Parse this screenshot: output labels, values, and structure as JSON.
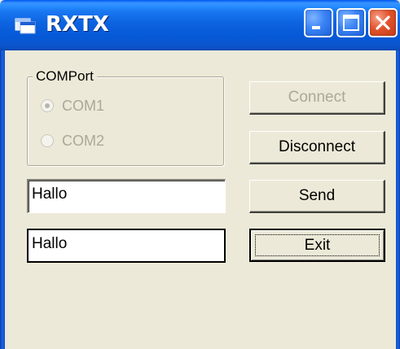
{
  "window": {
    "title": "RXTX",
    "icon": "app-window-icon",
    "caption_buttons": [
      "minimize-icon",
      "maximize-icon",
      "close-icon"
    ]
  },
  "comport": {
    "group_label": "COMPort",
    "options": [
      {
        "label": "COM1",
        "selected": true,
        "enabled": false
      },
      {
        "label": "COM2",
        "selected": false,
        "enabled": false
      }
    ]
  },
  "fields": {
    "send_text": "Hallo",
    "receive_text": "Hallo"
  },
  "buttons": {
    "connect": {
      "label": "Connect",
      "enabled": false
    },
    "disconnect": {
      "label": "Disconnect",
      "enabled": true
    },
    "send": {
      "label": "Send",
      "enabled": true
    },
    "exit": {
      "label": "Exit",
      "enabled": true,
      "focused": true
    }
  },
  "colors": {
    "titlebar": "#0a5ae0",
    "face": "#ece9d8",
    "close": "#e2532c",
    "disabled_text": "#aca899"
  }
}
